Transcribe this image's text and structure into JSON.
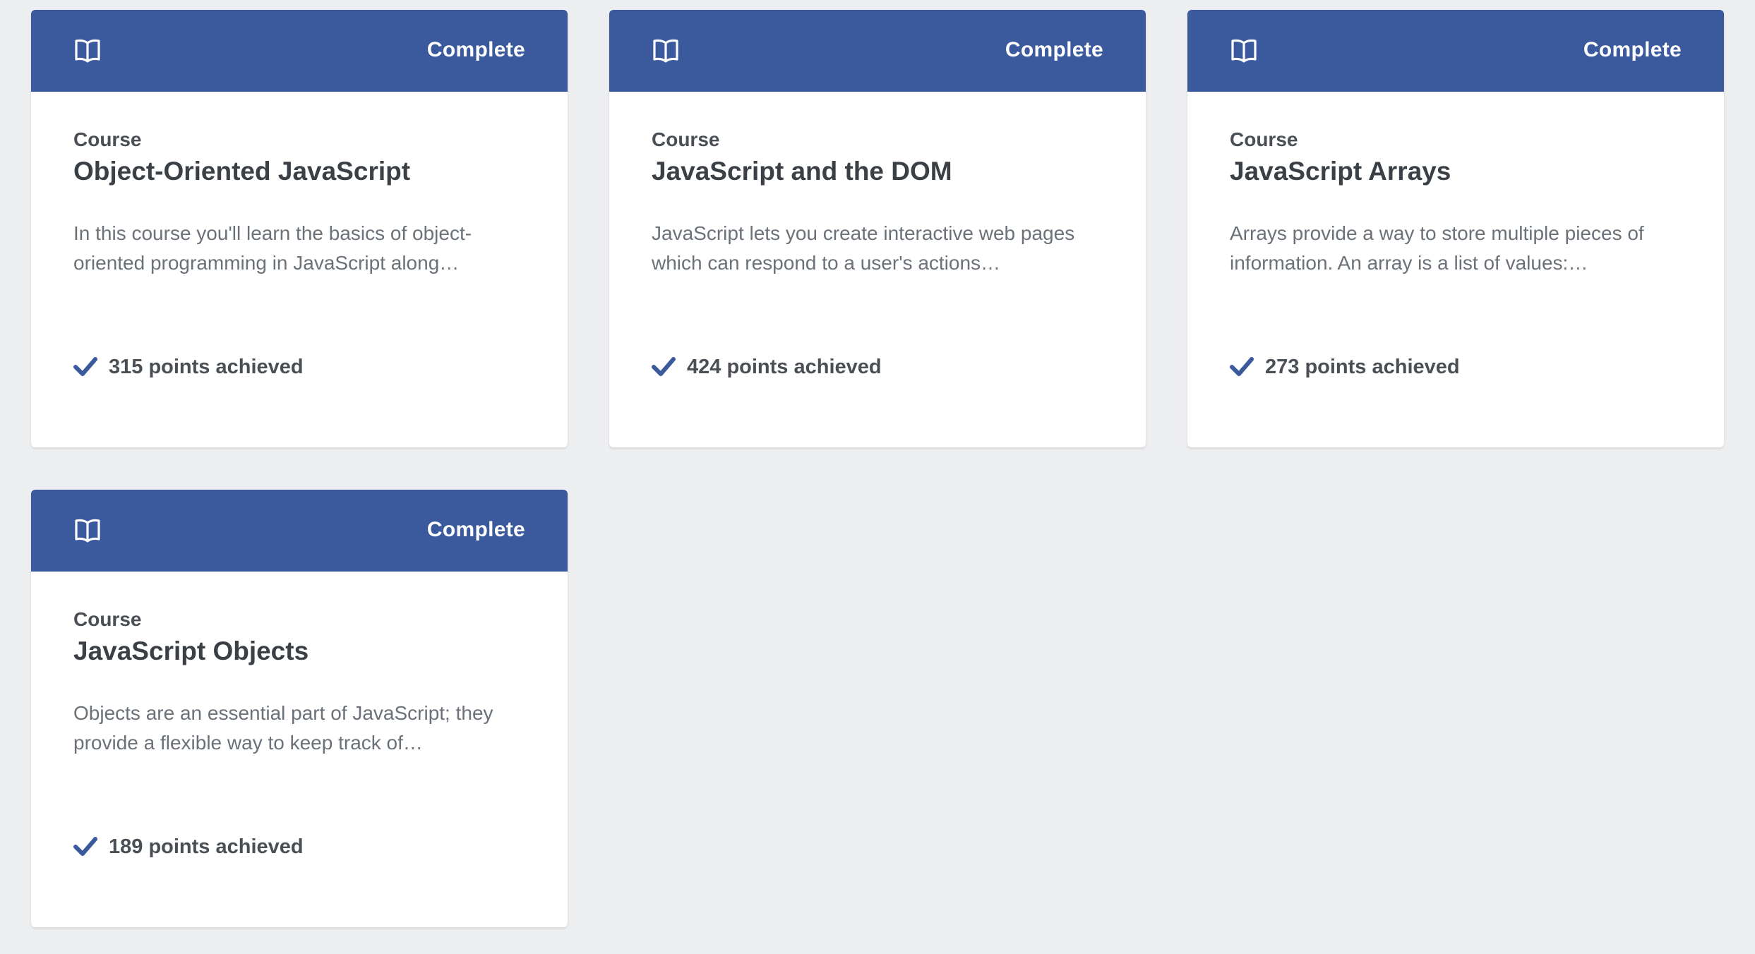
{
  "colors": {
    "background": "#edeef0",
    "card_header": "#3b5a9d",
    "check": "#3b5a9d"
  },
  "courses": [
    {
      "status": "Complete",
      "kind": "Course",
      "title": "Object-Oriented JavaScript",
      "description": "In this course you'll learn the basics of object-oriented programming in JavaScript along…",
      "points": "315 points achieved",
      "icon": "book-icon"
    },
    {
      "status": "Complete",
      "kind": "Course",
      "title": "JavaScript and the DOM",
      "description": "JavaScript lets you create interactive web pages which can respond to a user's actions…",
      "points": "424 points achieved",
      "icon": "book-icon"
    },
    {
      "status": "Complete",
      "kind": "Course",
      "title": "JavaScript Arrays",
      "description": "Arrays provide a way to store multiple pieces of information. An array is a list of values:…",
      "points": "273 points achieved",
      "icon": "book-icon"
    },
    {
      "status": "Complete",
      "kind": "Course",
      "title": "JavaScript Objects",
      "description": "Objects are an essential part of JavaScript; they provide a flexible way to keep track of…",
      "points": "189 points achieved",
      "icon": "book-icon"
    }
  ]
}
